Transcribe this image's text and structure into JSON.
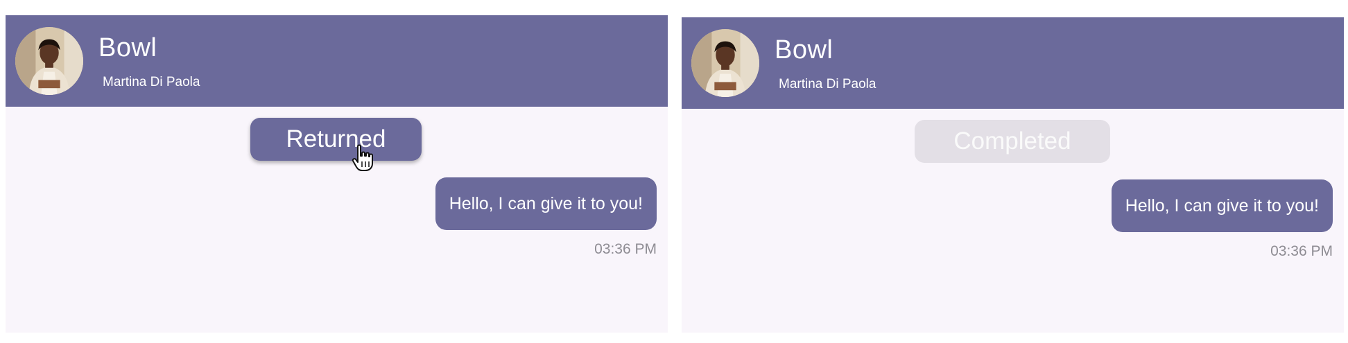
{
  "screens": [
    {
      "header": {
        "title": "Bowl",
        "subtitle": "Martina Di Paola",
        "avatar_icon": "profile-photo"
      },
      "status_button": {
        "label": "Returned",
        "state": "active",
        "color": "#6b6a9b"
      },
      "message": {
        "text": "Hello, I can give it to you!",
        "time": "03:36 PM"
      }
    },
    {
      "header": {
        "title": "Bowl",
        "subtitle": "Martina Di Paola",
        "avatar_icon": "profile-photo"
      },
      "status_button": {
        "label": "Completed",
        "state": "disabled",
        "color": "#e3dfe6"
      },
      "message": {
        "text": "Hello, I can give it to you!",
        "time": "03:36 PM"
      }
    }
  ],
  "colors": {
    "header_bg": "#6b6a9b",
    "body_bg": "#f9f5fb",
    "bubble_bg": "#6b6a9b",
    "timestamp": "#8e8c93"
  },
  "cursor_icon": "hand-pointer-icon"
}
